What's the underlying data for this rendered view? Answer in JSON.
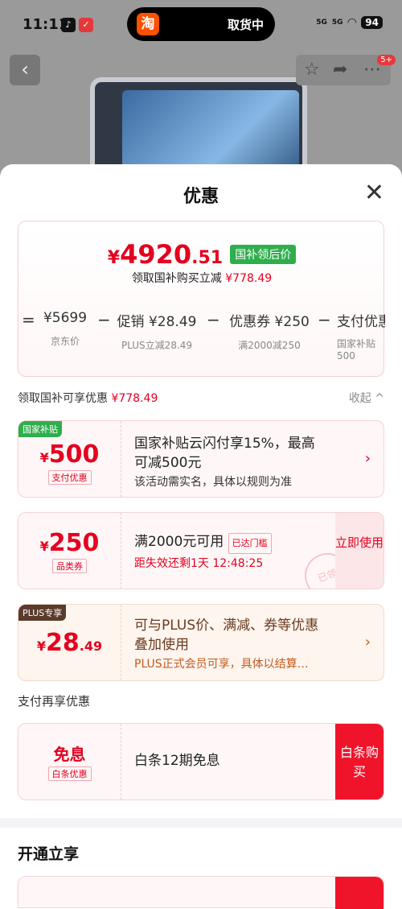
{
  "status": {
    "time": "11:11",
    "island_label": "取货中",
    "island_app": "淘",
    "battery": "94",
    "badge": "5+",
    "net1": "5G",
    "net2": "5G"
  },
  "sheet": {
    "title": "优惠"
  },
  "price": {
    "currency": "¥",
    "int": "4920",
    "dec": ".51",
    "tag": "国补领后价",
    "subtitle": "领取国补购买立减",
    "subtitle_amount": "¥778.49",
    "breakdown": [
      {
        "op": "=",
        "value": "¥5699",
        "label": "京东价"
      },
      {
        "op": "−",
        "value": "促销 ¥28.49",
        "label": "PLUS立减28.49"
      },
      {
        "op": "−",
        "value": "优惠券 ¥250",
        "label": "满2000减250"
      },
      {
        "op": "−",
        "value": "支付优惠",
        "label": "国家补贴\n500"
      }
    ]
  },
  "section1": {
    "label": "领取国补可享优惠",
    "amount": "¥778.49",
    "collapse": "收起 ^"
  },
  "cards": [
    {
      "corner": "国家补贴",
      "currency": "¥",
      "amount": "500",
      "amount_dec": "",
      "tag": "支付优惠",
      "line1": "国家补贴云闪付享15%，最高",
      "line2": "可减500元",
      "line3": "该活动需实名，具体以规则为准",
      "chev": "›"
    },
    {
      "currency": "¥",
      "amount": "250",
      "amount_dec": "",
      "tag": "品类券",
      "line1": "满2000元可用",
      "badge": "已达门槛",
      "line2": "距失效还剩1天 12:48:25",
      "button": "立即使用",
      "stamp": "已领"
    },
    {
      "corner": "PLUS专享",
      "currency": "¥",
      "amount": "28",
      "amount_dec": ".49",
      "line1": "可与PLUS价、满减、券等优惠",
      "line2": "叠加使用",
      "line3": "PLUS正式会员可享，具体以结算…",
      "chev": "›"
    }
  ],
  "section2": {
    "label": "支付再享优惠"
  },
  "pay_card": {
    "title": "免息",
    "tag": "白条优惠",
    "text": "白条12期免息",
    "button": "白条购买"
  },
  "section3": {
    "label": "开通立享"
  },
  "colors": {
    "accent": "#e4001f",
    "green": "#2fae4d",
    "button_red": "#f0142b"
  }
}
